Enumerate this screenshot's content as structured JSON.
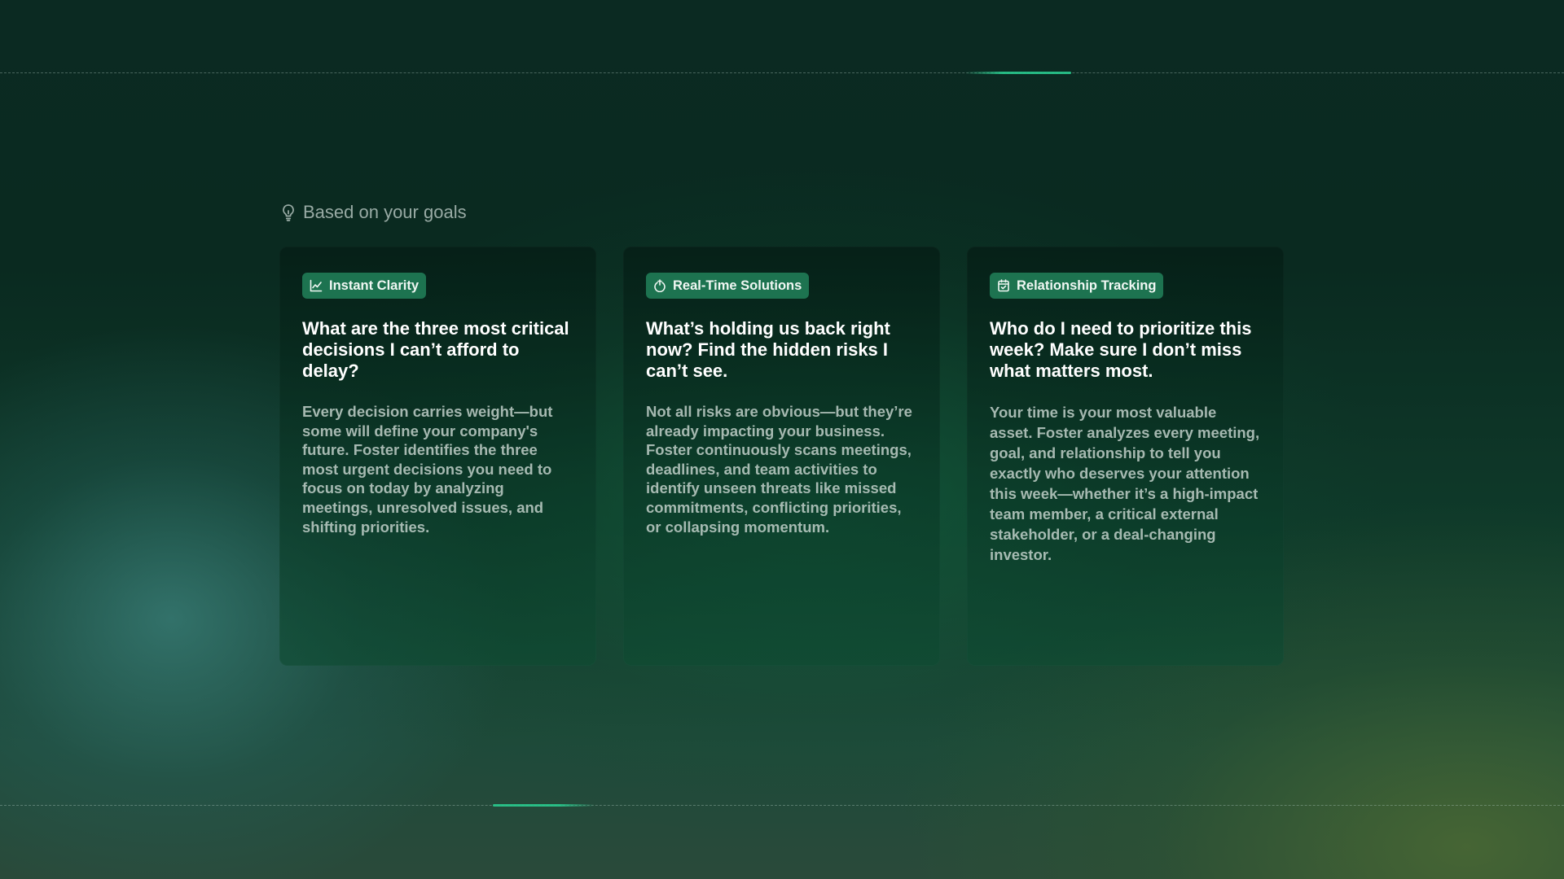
{
  "section": {
    "title": "Based on your goals",
    "icon": "lightbulb-icon"
  },
  "cards": [
    {
      "badge": "Instant Clarity",
      "badge_icon": "chart-line-icon",
      "title": "What are the three most critical decisions I can’t afford to delay?",
      "description": "Every decision carries weight—but some will define your company's future. Foster identifies the three most urgent decisions you need to focus on today by analyzing meetings, unresolved issues, and shifting priorities."
    },
    {
      "badge": "Real-Time Solutions",
      "badge_icon": "lifebuoy-icon",
      "title": "What’s holding us back right now? Find the hidden risks I can’t see.",
      "description": "Not all risks are obvious—but they’re already impacting your business. Foster continuously scans meetings, deadlines, and team activities to identify unseen threats like missed commitments, conflicting priorities, or collapsing momentum."
    },
    {
      "badge": "Relationship Tracking",
      "badge_icon": "calendar-check-icon",
      "title": "Who do I need to prioritize this week? Make sure I don’t miss what matters most.",
      "description": "Your time is your most valuable asset. Foster analyzes every meeting, goal, and relationship to tell you exactly who deserves your attention this week—whether it’s a high-impact team member, a critical external stakeholder, or a deal-changing investor."
    }
  ],
  "colors": {
    "badge_bg": "#1d7350",
    "accent": "#28c88c",
    "background": "#0b2a22"
  }
}
